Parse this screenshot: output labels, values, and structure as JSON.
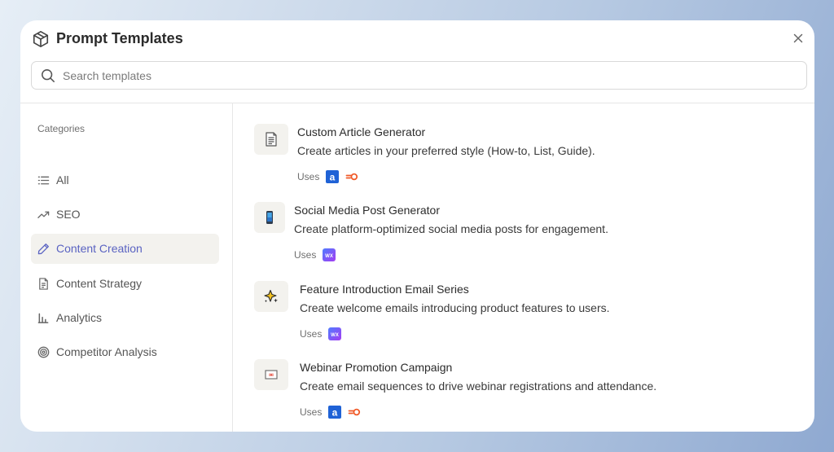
{
  "header": {
    "title": "Prompt Templates",
    "logo_icon": "box-icon",
    "close_icon": "close-icon"
  },
  "search": {
    "placeholder": "Search templates",
    "value": ""
  },
  "sidebar": {
    "label": "Categories",
    "items": [
      {
        "label": "All",
        "icon": "list-icon",
        "active": false
      },
      {
        "label": "SEO",
        "icon": "trending-up-icon",
        "active": false
      },
      {
        "label": "Content Creation",
        "icon": "pencil-icon",
        "active": true
      },
      {
        "label": "Content Strategy",
        "icon": "document-icon",
        "active": false
      },
      {
        "label": "Analytics",
        "icon": "bar-chart-icon",
        "active": false
      },
      {
        "label": "Competitor Analysis",
        "icon": "target-icon",
        "active": false
      }
    ]
  },
  "colors": {
    "accent": "#5a63c2",
    "active_bg": "#f3f2ee",
    "ahrefs_blue": "#1f62d6",
    "semrush_orange": "#f05a28",
    "wix_purple": "#6a3cf4"
  },
  "templates": [
    {
      "title": "Custom Article Generator",
      "description": "Create articles in your preferred style (How-to, List, Guide).",
      "icon": "document-icon",
      "uses_label": "Uses",
      "tools": [
        "ahrefs-icon",
        "semrush-icon"
      ]
    },
    {
      "title": "Social Media Post Generator",
      "description": "Create platform-optimized social media posts for engagement.",
      "icon": "mobile-phone-icon",
      "uses_label": "Uses",
      "tools": [
        "wix-icon"
      ]
    },
    {
      "title": "Feature Introduction Email Series",
      "description": "Create welcome emails introducing product features to users.",
      "icon": "sparkle-icon",
      "uses_label": "Uses",
      "tools": [
        "wix-icon"
      ]
    },
    {
      "title": "Webinar Promotion Campaign",
      "description": "Create email sequences to drive webinar registrations and attendance.",
      "icon": "presentation-icon",
      "uses_label": "Uses",
      "tools": [
        "ahrefs-icon",
        "semrush-icon"
      ]
    }
  ]
}
